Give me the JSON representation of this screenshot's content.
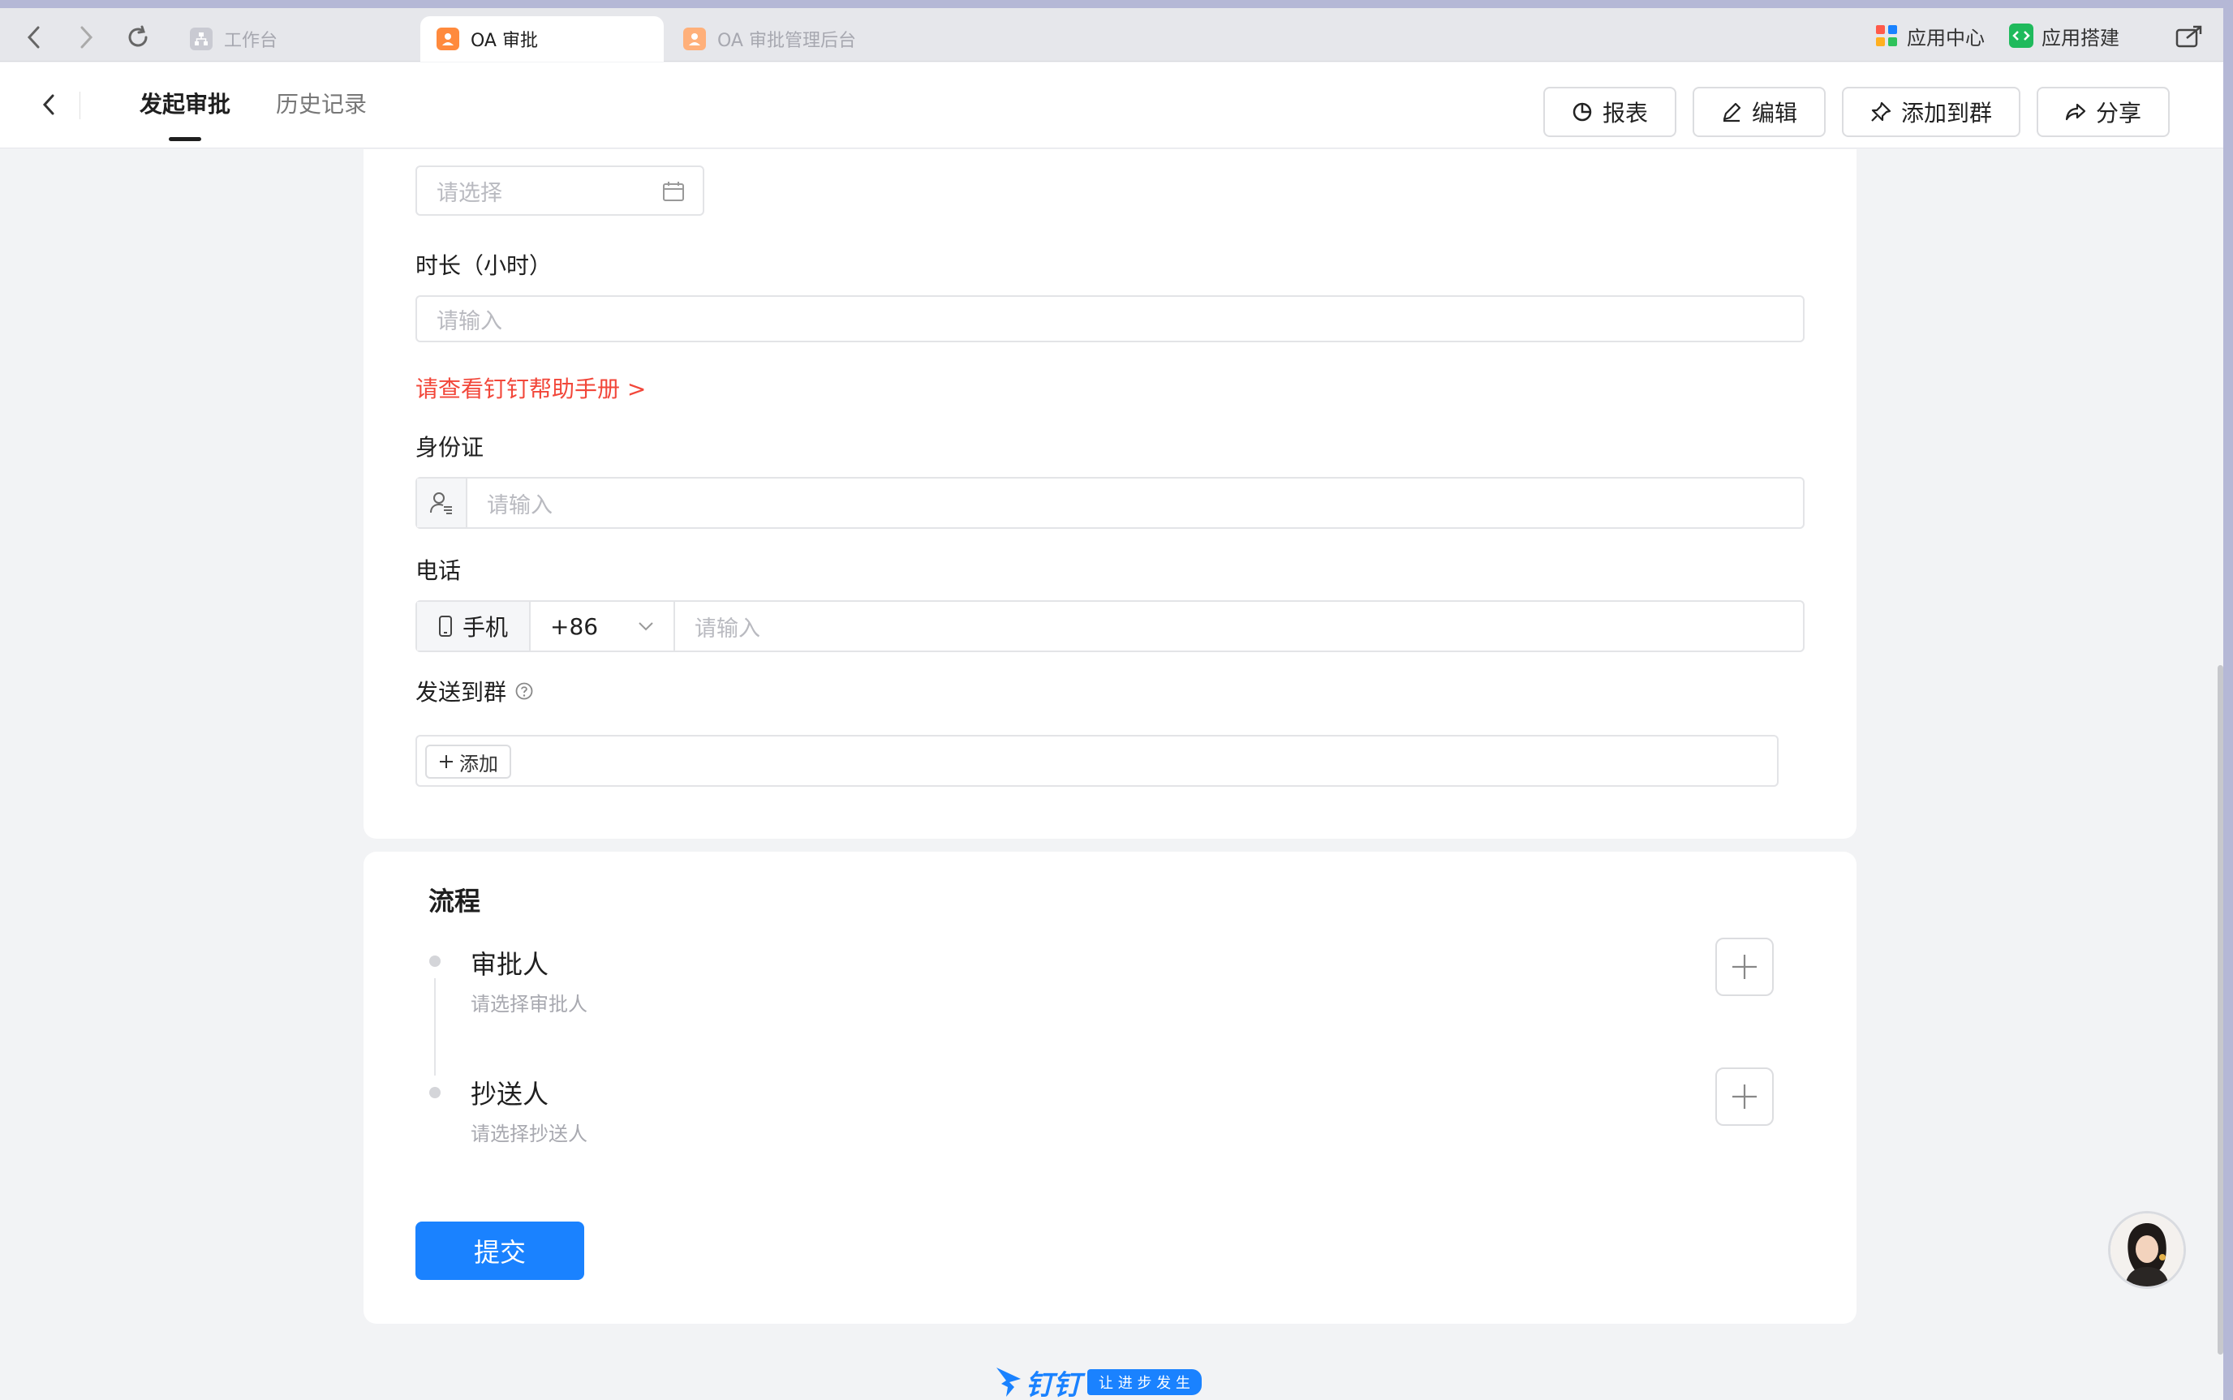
{
  "tabs": [
    {
      "label": "工作台",
      "icon": "org-chart-icon"
    },
    {
      "label": "OA 审批",
      "icon": "approval-user-icon"
    },
    {
      "label": "OA 审批管理后台",
      "icon": "approval-user-icon"
    }
  ],
  "top_right": {
    "app_center": "应用中心",
    "app_build": "应用搭建"
  },
  "header": {
    "tab_start": "发起审批",
    "tab_history": "历史记录",
    "btn_report": "报表",
    "btn_edit": "编辑",
    "btn_add_group": "添加到群",
    "btn_share": "分享"
  },
  "form": {
    "date_placeholder": "请选择",
    "duration_label": "时长（小时）",
    "duration_placeholder": "请输入",
    "help_link": "请查看钉钉帮助手册 >",
    "id_label": "身份证",
    "id_placeholder": "请输入",
    "phone_label": "电话",
    "phone_type": "手机",
    "phone_code": "+86",
    "phone_placeholder": "请输入",
    "send_group_label": "发送到群",
    "add_label": "添加"
  },
  "process": {
    "title": "流程",
    "approver_title": "审批人",
    "approver_sub": "请选择审批人",
    "cc_title": "抄送人",
    "cc_sub": "请选择抄送人"
  },
  "submit_label": "提交",
  "footer": {
    "brand": "钉钉",
    "slogan": "让 进 步 发 生"
  },
  "colors": {
    "primary": "#1a82ff",
    "link_red": "#f2473a",
    "brand_blue": "#1a82ff"
  }
}
